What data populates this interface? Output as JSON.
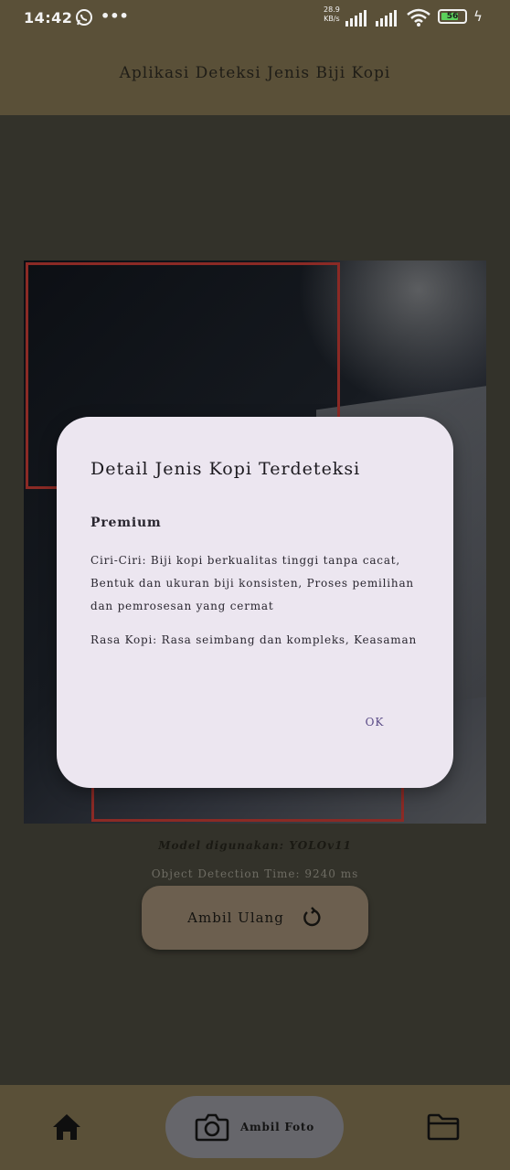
{
  "status_bar": {
    "time": "14:42",
    "more": "•••",
    "net_speed_value": "28.9",
    "net_speed_unit": "KB/s",
    "battery": "56",
    "icons": [
      "whatsapp-icon",
      "signal-icon",
      "signal-icon",
      "wifi-icon",
      "battery-icon",
      "charging-icon"
    ]
  },
  "app_bar": {
    "title": "Aplikasi Deteksi Jenis Biji Kopi"
  },
  "main": {
    "model_label": "Model digunakan: YOLOv11",
    "time_label": "Object Detection Time: 9240 ms",
    "retake_button": "Ambil Ulang"
  },
  "dialog": {
    "title": "Detail Jenis Kopi Terdeteksi",
    "grade": "Premium",
    "characteristics": "Ciri-Ciri: Biji kopi berkualitas tinggi tanpa cacat, Bentuk dan ukuran biji konsisten, Proses pemilihan dan pemrosesan yang cermat",
    "taste": "Rasa Kopi: Rasa seimbang dan kompleks, Keasaman",
    "ok_button": "OK"
  },
  "bottom_nav": {
    "camera_label": "Ambil Foto",
    "icons": [
      "home-icon",
      "camera-icon",
      "folder-icon"
    ]
  },
  "colors": {
    "bar": "#5a5038",
    "background": "#33322a",
    "dialog": "#ece6f0",
    "accent": "#5a4b86",
    "bbox": "#8b2a25"
  }
}
